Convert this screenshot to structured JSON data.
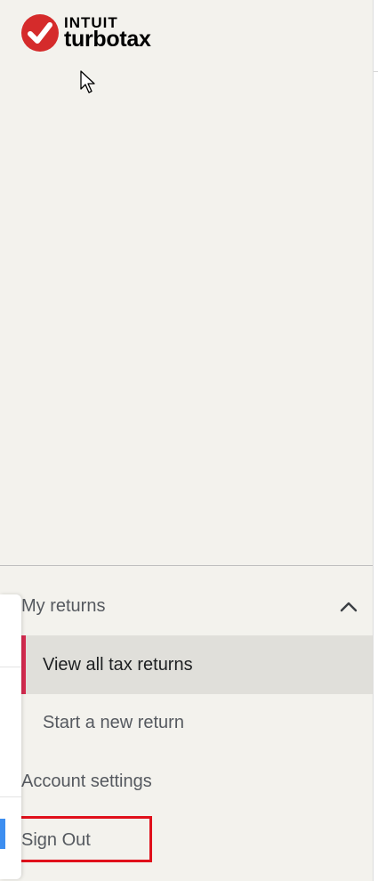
{
  "brand": {
    "company": "INTUIT",
    "product": "turbotax",
    "logo_icon": "red-circle-checkmark-icon",
    "colors": {
      "red": "#d52b2b",
      "text": "#000000"
    }
  },
  "nav": {
    "my_returns": {
      "label": "My returns",
      "expanded": true,
      "icon": "chevron-up-icon"
    },
    "sub_items": [
      {
        "label": "View all tax returns",
        "selected": true
      },
      {
        "label": "Start a new return",
        "selected": false
      }
    ],
    "account_settings": "Account settings",
    "sign_out": "Sign Out"
  },
  "colors": {
    "sidebar_bg": "#f3f2ed",
    "selected_bg": "#e0dfda",
    "selected_accent": "#d52b4f",
    "nav_text": "#55595f",
    "highlight_border": "#e0101b"
  }
}
